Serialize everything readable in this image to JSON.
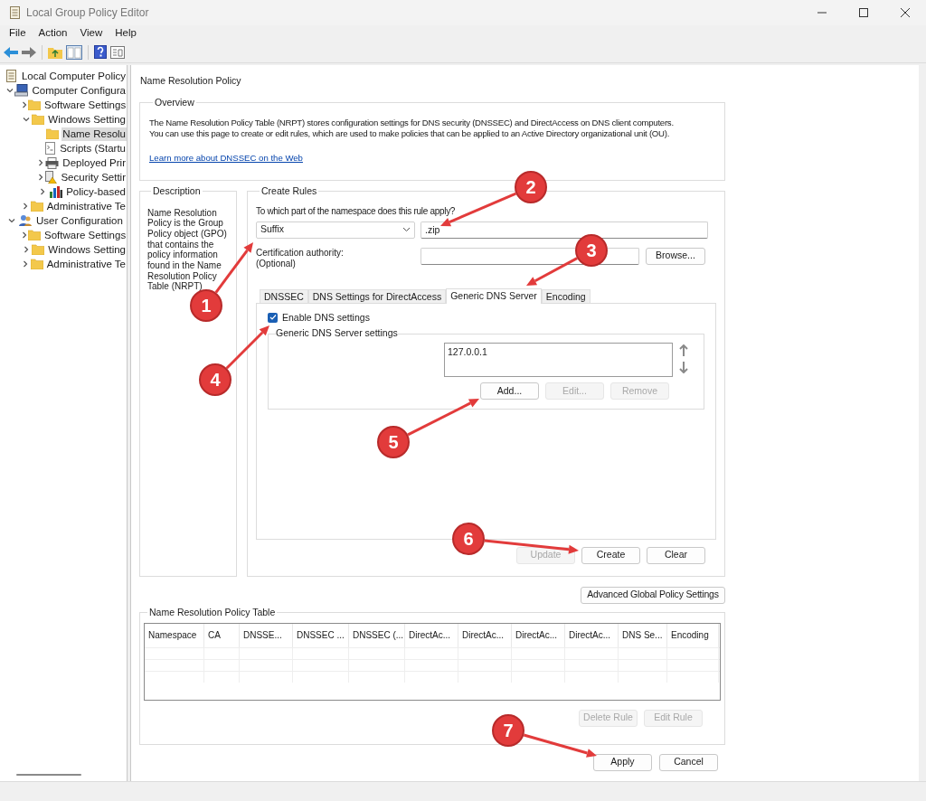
{
  "window": {
    "title": "Local Group Policy Editor"
  },
  "menu": [
    "File",
    "Action",
    "View",
    "Help"
  ],
  "tree": [
    {
      "label": "Local Computer Policy",
      "kind": "policy",
      "selected": false,
      "children": [
        {
          "label": "Computer Configura",
          "kind": "computer",
          "expanded": true,
          "selected": false,
          "children": [
            {
              "label": "Software Settings",
              "kind": "folder",
              "expanded": false,
              "selected": false
            },
            {
              "label": "Windows Setting",
              "kind": "folder",
              "expanded": true,
              "selected": false,
              "children": [
                {
                  "label": "Name Resolu",
                  "kind": "folder",
                  "selected": true
                },
                {
                  "label": "Scripts (Startu",
                  "kind": "script",
                  "selected": false
                },
                {
                  "label": "Deployed Prir",
                  "kind": "printer",
                  "expanded": false,
                  "selected": false
                },
                {
                  "label": "Security Settir",
                  "kind": "security",
                  "expanded": false,
                  "selected": false
                },
                {
                  "label": "Policy-based",
                  "kind": "chart",
                  "expanded": false,
                  "selected": false
                }
              ]
            },
            {
              "label": "Administrative Te",
              "kind": "folder",
              "expanded": false,
              "selected": false
            }
          ]
        },
        {
          "label": "User Configuration",
          "kind": "user",
          "expanded": true,
          "selected": false,
          "children": [
            {
              "label": "Software Settings",
              "kind": "folder",
              "expanded": false,
              "selected": false
            },
            {
              "label": "Windows Setting",
              "kind": "folder",
              "expanded": false,
              "selected": false
            },
            {
              "label": "Administrative Te",
              "kind": "folder",
              "expanded": false,
              "selected": false
            }
          ]
        }
      ]
    }
  ],
  "page_title": "Name Resolution Policy",
  "overview": {
    "title": "Overview",
    "paragraphs": [
      "The Name Resolution Policy Table (NRPT) stores configuration settings for DNS security (DNSSEC) and DirectAccess on DNS client computers.",
      "You can use this page to create or edit rules, which are used to make policies that can be applied to an Active Directory organizational unit (OU)."
    ],
    "link": "Learn more about DNSSEC on the Web"
  },
  "description": {
    "title": "Description",
    "text": "Name Resolution Policy is the Group Policy object (GPO) that contains the policy information found in the Name Resolution Policy Table (NRPT)"
  },
  "create_rules": {
    "title": "Create Rules",
    "namespace_label": "To which part of the namespace does this rule apply?",
    "namespace_type": "Suffix",
    "namespace_value": ".zip",
    "ca_label": "Certification authority:",
    "ca_hint": "(Optional)",
    "browse": "Browse...",
    "tabs": [
      {
        "label": "DNSSEC",
        "selected": false
      },
      {
        "label": "DNS Settings for DirectAccess",
        "selected": false
      },
      {
        "label": "Generic DNS Server",
        "selected": true
      },
      {
        "label": "Encoding",
        "selected": false
      }
    ],
    "enable_dns": {
      "label": "Enable DNS settings",
      "checked": true
    },
    "server_group": "Generic DNS Server settings",
    "servers": [
      "127.0.0.1"
    ],
    "server_buttons": [
      {
        "label": "Add...",
        "disabled": false
      },
      {
        "label": "Edit...",
        "disabled": true
      },
      {
        "label": "Remove",
        "disabled": true
      }
    ],
    "buttons": [
      {
        "label": "Update",
        "disabled": true
      },
      {
        "label": "Create",
        "disabled": false
      },
      {
        "label": "Clear",
        "disabled": false
      }
    ]
  },
  "advanced_button": "Advanced Global Policy Settings",
  "policy_table": {
    "title": "Name Resolution Policy Table",
    "columns": [
      "Namespace",
      "CA",
      "DNSSE...",
      "DNSSEC ...",
      "DNSSEC (...",
      "DirectAc...",
      "DirectAc...",
      "DirectAc...",
      "DirectAc...",
      "DNS Se...",
      "Encoding"
    ],
    "buttons": [
      {
        "label": "Delete Rule",
        "disabled": true
      },
      {
        "label": "Edit Rule",
        "disabled": true
      }
    ]
  },
  "dialog_buttons": [
    {
      "label": "Apply",
      "disabled": false
    },
    {
      "label": "Cancel",
      "disabled": false
    }
  ],
  "annotations": [
    {
      "label": "1"
    },
    {
      "label": "2"
    },
    {
      "label": "3"
    },
    {
      "label": "4"
    },
    {
      "label": "5"
    },
    {
      "label": "6"
    },
    {
      "label": "7"
    }
  ]
}
